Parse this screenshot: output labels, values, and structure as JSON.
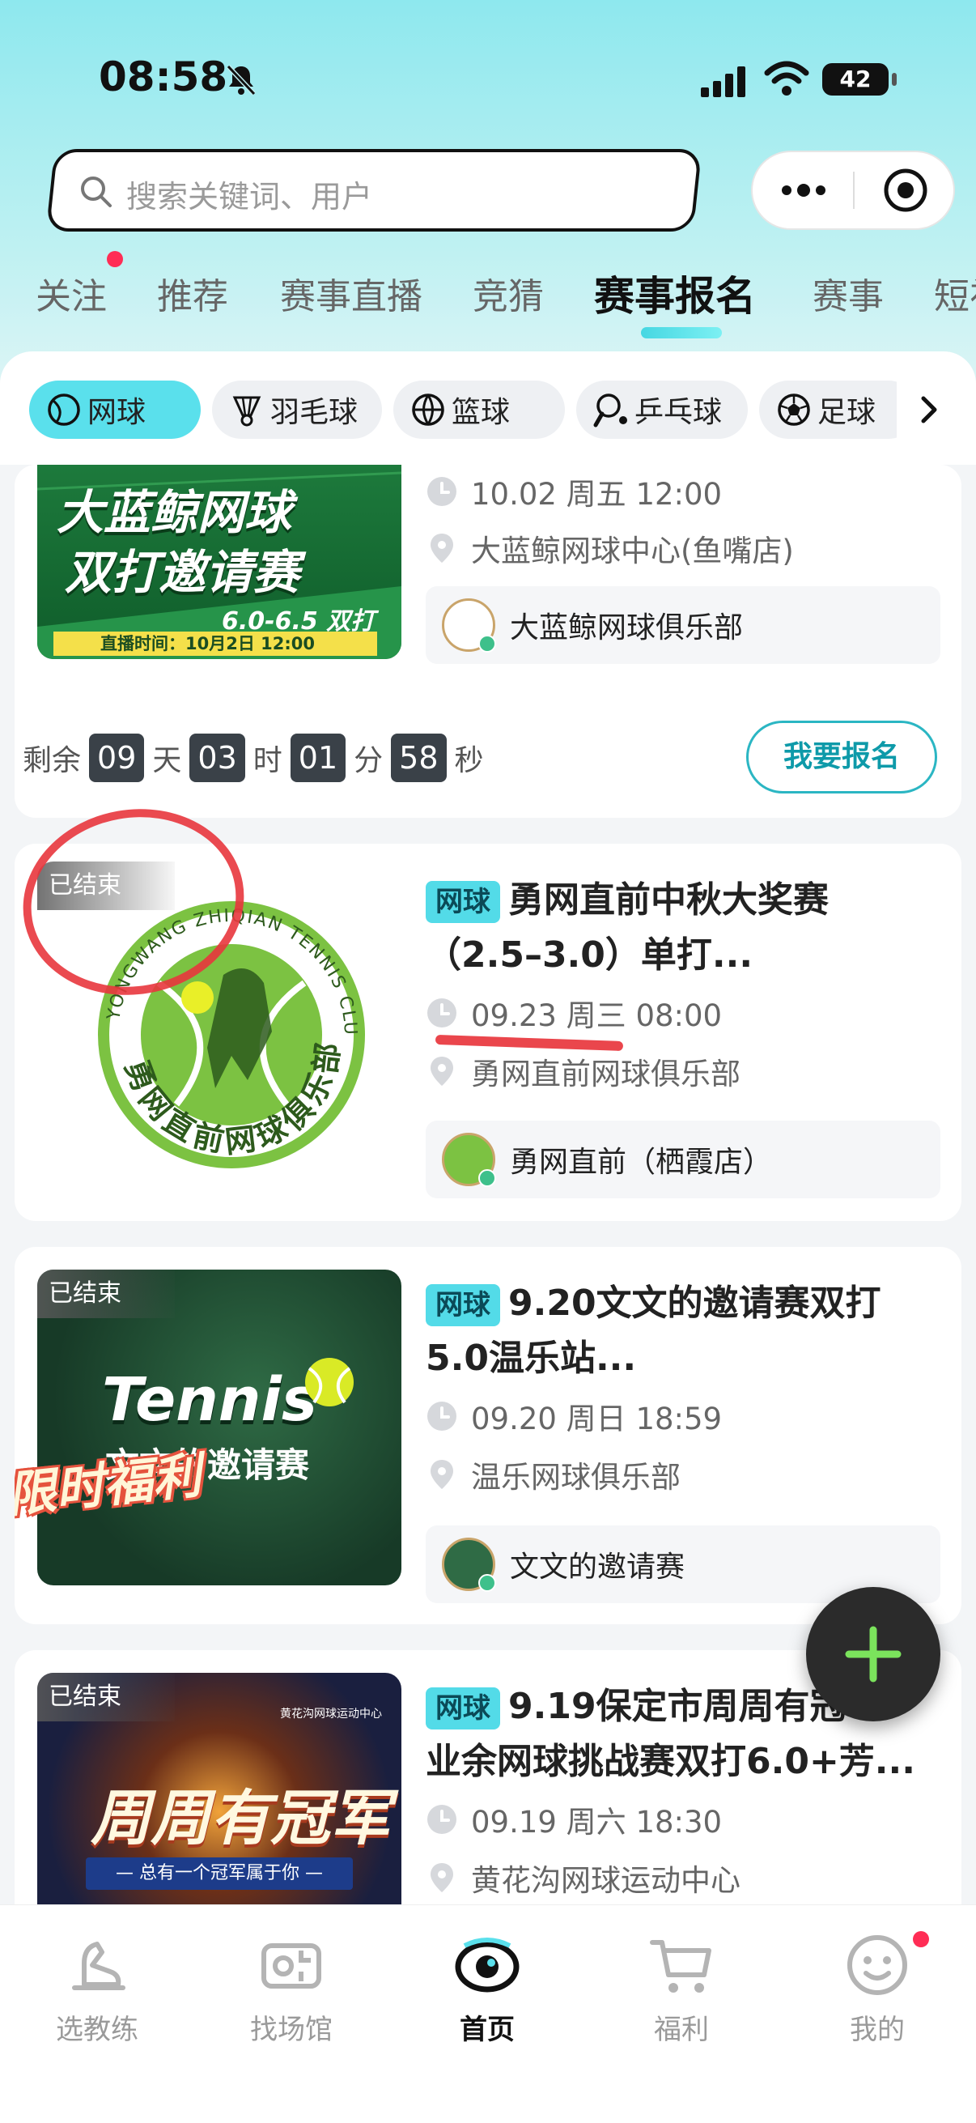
{
  "status_bar": {
    "time": "08:58",
    "battery": "42"
  },
  "search": {
    "placeholder": "搜索关键词、用户"
  },
  "top_tabs": [
    {
      "label": "关注"
    },
    {
      "label": "推荐"
    },
    {
      "label": "赛事直播"
    },
    {
      "label": "竞猜"
    },
    {
      "label": "赛事报名",
      "active": true
    },
    {
      "label": "赛事"
    },
    {
      "label": "短视"
    }
  ],
  "sport_chips": [
    {
      "label": "网球",
      "active": true
    },
    {
      "label": "羽毛球"
    },
    {
      "label": "篮球"
    },
    {
      "label": "乒乓球"
    },
    {
      "label": "足球"
    }
  ],
  "events": [
    {
      "poster_line1": "大蓝鲸网球",
      "poster_line2": "双打邀请赛",
      "poster_level": "6.0-6.5 双打",
      "poster_live": "直播时间：10月2日 12:00",
      "datetime": "10.02 周五 12:00",
      "venue": "大蓝鲸网球中心(鱼嘴店)",
      "club": "大蓝鲸网球俱乐部",
      "countdown": {
        "prefix": "剩余",
        "days": "09",
        "day_unit": "天",
        "hours": "03",
        "hour_unit": "时",
        "minutes": "01",
        "minute_unit": "分",
        "seconds": "58",
        "second_unit": "秒"
      },
      "button": "我要报名"
    },
    {
      "status": "已结束",
      "badge": "网球",
      "title_line1": "勇网直前中秋大奖赛",
      "title_line2": "（2.5–3.0）单打...",
      "datetime": "09.23 周三 08:00",
      "venue": "勇网直前网球俱乐部",
      "club": "勇网直前（栖霞店）",
      "logo_top_text": "YONGWANG ZHIQIAN TENNIS CLUB",
      "logo_bottom_text": "勇网直前网球俱乐部"
    },
    {
      "status": "已结束",
      "badge": "网球",
      "title_line1": "9.20文文的邀请赛双打",
      "title_line2": "5.0温乐站...",
      "datetime": "09.20 周日 18:59",
      "venue": "温乐网球俱乐部",
      "club": "文文的邀请赛",
      "poster_title": "Tennis",
      "poster_sub": "文文的邀请赛",
      "poster_promo": "限时福利"
    },
    {
      "status": "已结束",
      "badge": "网球",
      "title_line1": "9.19保定市周周有冠",
      "title_line2": "业余网球挑战赛双打6.0+芳...",
      "datetime": "09.19 周六 18:30",
      "venue": "黄花沟网球运动中心",
      "poster_title": "周周有冠军",
      "poster_sub": "— 总有一个冠军属于你 —",
      "poster_org": "黄花沟网球运动中心"
    }
  ],
  "bottom_nav": [
    {
      "label": "选教练"
    },
    {
      "label": "找场馆"
    },
    {
      "label": "首页",
      "active": true
    },
    {
      "label": "福利"
    },
    {
      "label": "我的"
    }
  ]
}
